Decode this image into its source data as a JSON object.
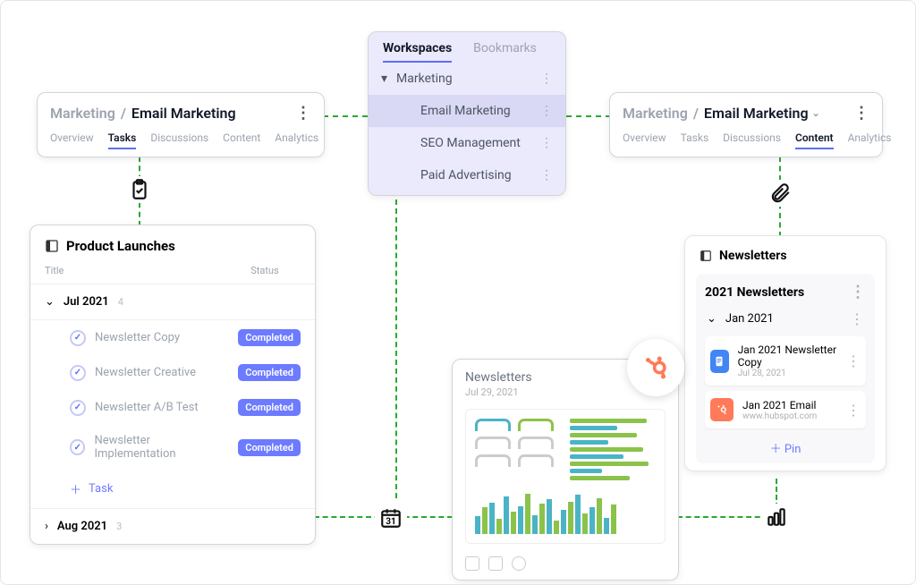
{
  "workspaces_panel": {
    "tabs": {
      "workspaces": "Workspaces",
      "bookmarks": "Bookmarks"
    },
    "root": "Marketing",
    "items": [
      "Email Marketing",
      "SEO Management",
      "Paid Advertising"
    ]
  },
  "breadcrumb": {
    "parent": "Marketing",
    "current": "Email Marketing"
  },
  "view_tabs": [
    "Overview",
    "Tasks",
    "Discussions",
    "Content",
    "Analytics"
  ],
  "left_active_tab": "Tasks",
  "right_active_tab": "Content",
  "tasks_panel": {
    "title": "Product Launches",
    "cols": {
      "title": "Title",
      "status": "Status"
    },
    "groups": [
      {
        "label": "Jul 2021",
        "count": "4",
        "expanded": true,
        "tasks": [
          {
            "name": "Newsletter Copy",
            "status": "Completed"
          },
          {
            "name": "Newsletter Creative",
            "status": "Completed"
          },
          {
            "name": "Newsletter A/B Test",
            "status": "Completed"
          },
          {
            "name": "Newsletter Implementation",
            "status": "Completed"
          }
        ]
      },
      {
        "label": "Aug 2021",
        "count": "3",
        "expanded": false
      }
    ],
    "add_label": "Task"
  },
  "report_card": {
    "title": "Newsletters",
    "date": "Jul 29, 2021"
  },
  "pins_panel": {
    "title": "Newsletters",
    "sub_title": "2021 Newsletters",
    "group": "Jan 2021",
    "items": [
      {
        "title": "Jan 2021 Newsletter Copy",
        "sub": "Jul 28, 2021",
        "kind": "doc"
      },
      {
        "title": "Jan 2021 Email",
        "sub": "www.hubspot.com",
        "kind": "hubspot"
      }
    ],
    "pin_label": "Pin"
  },
  "calendar_day": "31"
}
